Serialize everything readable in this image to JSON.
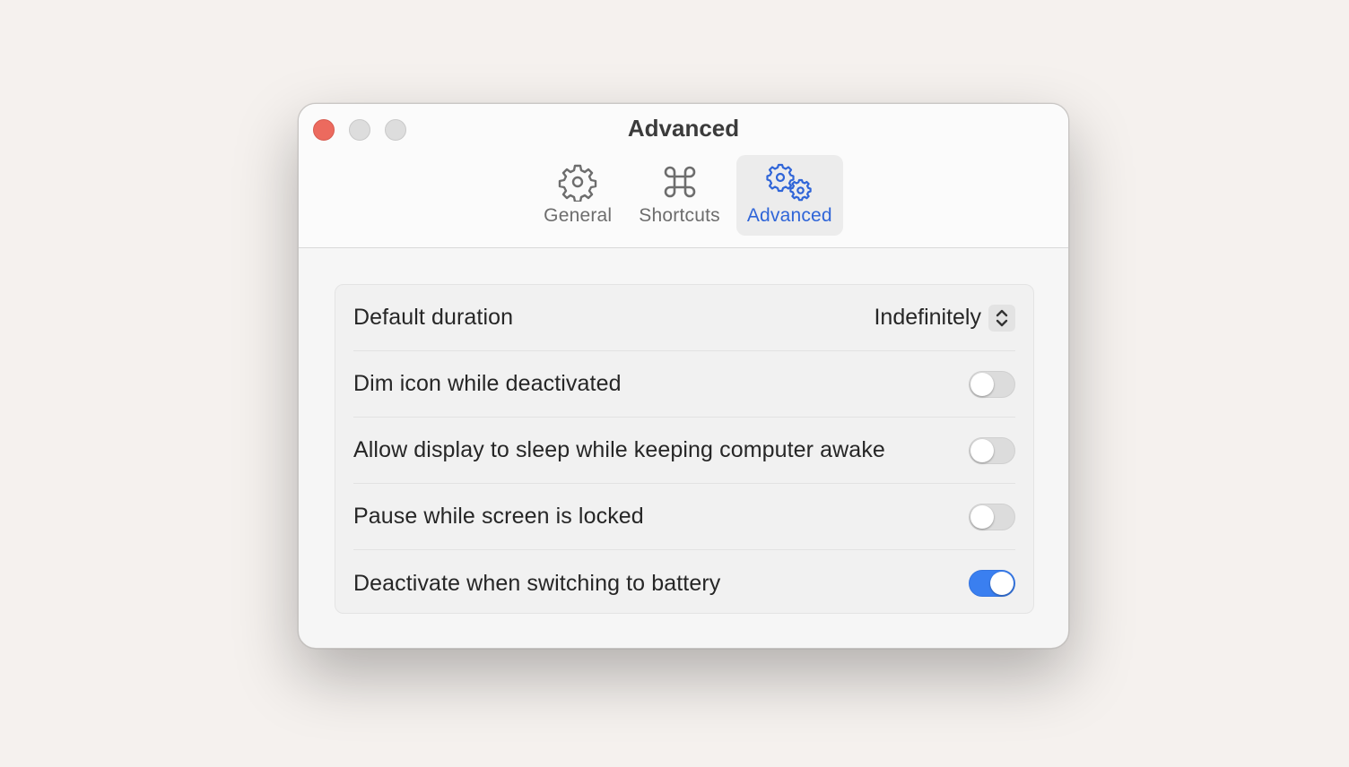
{
  "window": {
    "title": "Advanced",
    "controls": [
      "close",
      "minimize",
      "zoom"
    ]
  },
  "tabs": [
    {
      "label": "General",
      "icon": "gear-icon",
      "active": false
    },
    {
      "label": "Shortcuts",
      "icon": "command-icon",
      "active": false
    },
    {
      "label": "Advanced",
      "icon": "gears-icon",
      "active": true
    }
  ],
  "settings": {
    "default_duration": {
      "label": "Default duration",
      "value": "Indefinitely"
    },
    "toggles": [
      {
        "label": "Dim icon while deactivated",
        "on": false
      },
      {
        "label": "Allow display to sleep while keeping computer awake",
        "on": false
      },
      {
        "label": "Pause while screen is locked",
        "on": false
      },
      {
        "label": "Deactivate when switching to battery",
        "on": true
      }
    ]
  },
  "colors": {
    "accent": "#2f65d8",
    "toggle_on": "#3a7ff0",
    "close": "#ec6a5e"
  }
}
